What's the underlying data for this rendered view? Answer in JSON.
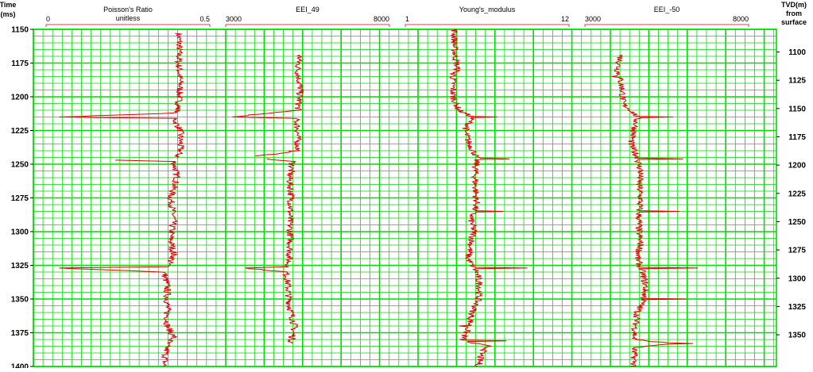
{
  "colors": {
    "grid": "#00dd00",
    "curve": "#e00000",
    "curve_dark": "#8a3a00",
    "header_line": "#e04040",
    "text": "#000000",
    "background": "#ffffff"
  },
  "left_axis": {
    "label_line1": "Time",
    "label_line2": "(ms)",
    "ticks": [
      1150,
      1175,
      1200,
      1225,
      1250,
      1275,
      1300,
      1325,
      1350,
      1375,
      1400
    ]
  },
  "right_axis": {
    "label_line1": "TVD(m)",
    "label_line2": "from",
    "label_line3": "surface",
    "ticks": [
      1100,
      1125,
      1150,
      1175,
      1200,
      1225,
      1250,
      1275,
      1300,
      1325,
      1350
    ]
  },
  "chart_data": {
    "type": "line",
    "y_axis": "Time (ms)",
    "ylim": [
      1150,
      1400
    ],
    "secondary_y_axis": "TVD(m) from surface",
    "secondary_ylim": [
      1080,
      1378
    ],
    "grid": true,
    "tracks": [
      {
        "name": "Poisson's Ratio",
        "unit": "unitless",
        "xmin_label": "0",
        "xmax_label": "0.5",
        "xlim": [
          0,
          0.5
        ],
        "segments": [
          [
            1153,
            1245
          ],
          [
            1247,
            1400
          ]
        ],
        "profile": [
          [
            1153,
            0.405
          ],
          [
            1160,
            0.407
          ],
          [
            1175,
            0.405
          ],
          [
            1190,
            0.41
          ],
          [
            1205,
            0.405
          ],
          [
            1212,
            0.4
          ],
          [
            1215,
            0.04
          ],
          [
            1216,
            0.39
          ],
          [
            1225,
            0.41
          ],
          [
            1240,
            0.41
          ],
          [
            1245,
            0.4
          ],
          [
            1246,
            0.03
          ],
          [
            1248,
            0.39
          ],
          [
            1260,
            0.4
          ],
          [
            1275,
            0.38
          ],
          [
            1290,
            0.39
          ],
          [
            1305,
            0.38
          ],
          [
            1318,
            0.39
          ],
          [
            1326,
            0.37
          ],
          [
            1327,
            0.04
          ],
          [
            1330,
            0.36
          ],
          [
            1340,
            0.37
          ],
          [
            1355,
            0.37
          ],
          [
            1370,
            0.37
          ],
          [
            1378,
            0.39
          ],
          [
            1383,
            0.37
          ],
          [
            1400,
            0.36
          ]
        ],
        "spikes": [
          [
            1215,
            0.04
          ],
          [
            1246,
            0.03
          ],
          [
            1327,
            0.04
          ]
        ]
      },
      {
        "name": "EEI_49",
        "unit": "",
        "xmin_label": "3000",
        "xmax_label": "8000",
        "xlim": [
          3000,
          8000
        ],
        "segments": [
          [
            1169,
            1244
          ],
          [
            1246,
            1383
          ]
        ],
        "profile": [
          [
            1169,
            5260
          ],
          [
            1180,
            5200
          ],
          [
            1195,
            5280
          ],
          [
            1210,
            5200
          ],
          [
            1215,
            3200
          ],
          [
            1216,
            5150
          ],
          [
            1225,
            5200
          ],
          [
            1240,
            5200
          ],
          [
            1245,
            3700
          ],
          [
            1248,
            5050
          ],
          [
            1260,
            4950
          ],
          [
            1275,
            5000
          ],
          [
            1290,
            4950
          ],
          [
            1305,
            4980
          ],
          [
            1318,
            4950
          ],
          [
            1326,
            4900
          ],
          [
            1327,
            3600
          ],
          [
            1330,
            4850
          ],
          [
            1340,
            4900
          ],
          [
            1355,
            4950
          ],
          [
            1370,
            5100
          ],
          [
            1383,
            5000
          ]
        ],
        "spikes": [
          [
            1215,
            3200
          ],
          [
            1245,
            3700
          ],
          [
            1327,
            3600
          ]
        ]
      },
      {
        "name": "Young's_modulus",
        "unit": "",
        "xmin_label": "1",
        "xmax_label": "12",
        "xlim": [
          1,
          12
        ],
        "segments": [
          [
            1150,
            1400
          ]
        ],
        "profile": [
          [
            1150,
            4.3
          ],
          [
            1165,
            4.3
          ],
          [
            1180,
            4.5
          ],
          [
            1185,
            4.2
          ],
          [
            1200,
            4.2
          ],
          [
            1210,
            4.6
          ],
          [
            1215,
            5.5
          ],
          [
            1225,
            5.0
          ],
          [
            1235,
            5.3
          ],
          [
            1245,
            5.8
          ],
          [
            1255,
            5.7
          ],
          [
            1265,
            5.7
          ],
          [
            1280,
            5.8
          ],
          [
            1290,
            5.4
          ],
          [
            1300,
            5.6
          ],
          [
            1310,
            5.4
          ],
          [
            1320,
            5.2
          ],
          [
            1330,
            5.8
          ],
          [
            1340,
            6.0
          ],
          [
            1350,
            5.9
          ],
          [
            1360,
            5.5
          ],
          [
            1370,
            5.3
          ],
          [
            1381,
            4.8
          ],
          [
            1385,
            6.6
          ],
          [
            1390,
            6.1
          ],
          [
            1400,
            5.9
          ]
        ],
        "spikes": [
          [
            1183,
            4.0
          ],
          [
            1215,
            7.2
          ],
          [
            1246,
            8.0
          ],
          [
            1285,
            7.6
          ],
          [
            1327,
            9.2
          ],
          [
            1370,
            4.6
          ],
          [
            1381,
            7.8
          ]
        ]
      },
      {
        "name": "EEI_-50",
        "unit": "",
        "xmin_label": "3000",
        "xmax_label": "8000",
        "xlim": [
          3000,
          8000
        ],
        "segments": [
          [
            1169,
            1400
          ]
        ],
        "profile": [
          [
            1169,
            4100
          ],
          [
            1180,
            4000
          ],
          [
            1195,
            4150
          ],
          [
            1205,
            4150
          ],
          [
            1210,
            4400
          ],
          [
            1215,
            4600
          ],
          [
            1225,
            4500
          ],
          [
            1235,
            4400
          ],
          [
            1245,
            4600
          ],
          [
            1255,
            4700
          ],
          [
            1265,
            4650
          ],
          [
            1275,
            4700
          ],
          [
            1285,
            4650
          ],
          [
            1300,
            4650
          ],
          [
            1310,
            4700
          ],
          [
            1320,
            4600
          ],
          [
            1330,
            4750
          ],
          [
            1340,
            4850
          ],
          [
            1350,
            4800
          ],
          [
            1360,
            4600
          ],
          [
            1370,
            4550
          ],
          [
            1380,
            4500
          ],
          [
            1383,
            5700
          ],
          [
            1386,
            4500
          ],
          [
            1400,
            4500
          ]
        ],
        "spikes": [
          [
            1185,
            3800
          ],
          [
            1215,
            5700
          ],
          [
            1246,
            6000
          ],
          [
            1285,
            5900
          ],
          [
            1327,
            6450
          ],
          [
            1350,
            6100
          ],
          [
            1383,
            6300
          ]
        ]
      }
    ]
  }
}
